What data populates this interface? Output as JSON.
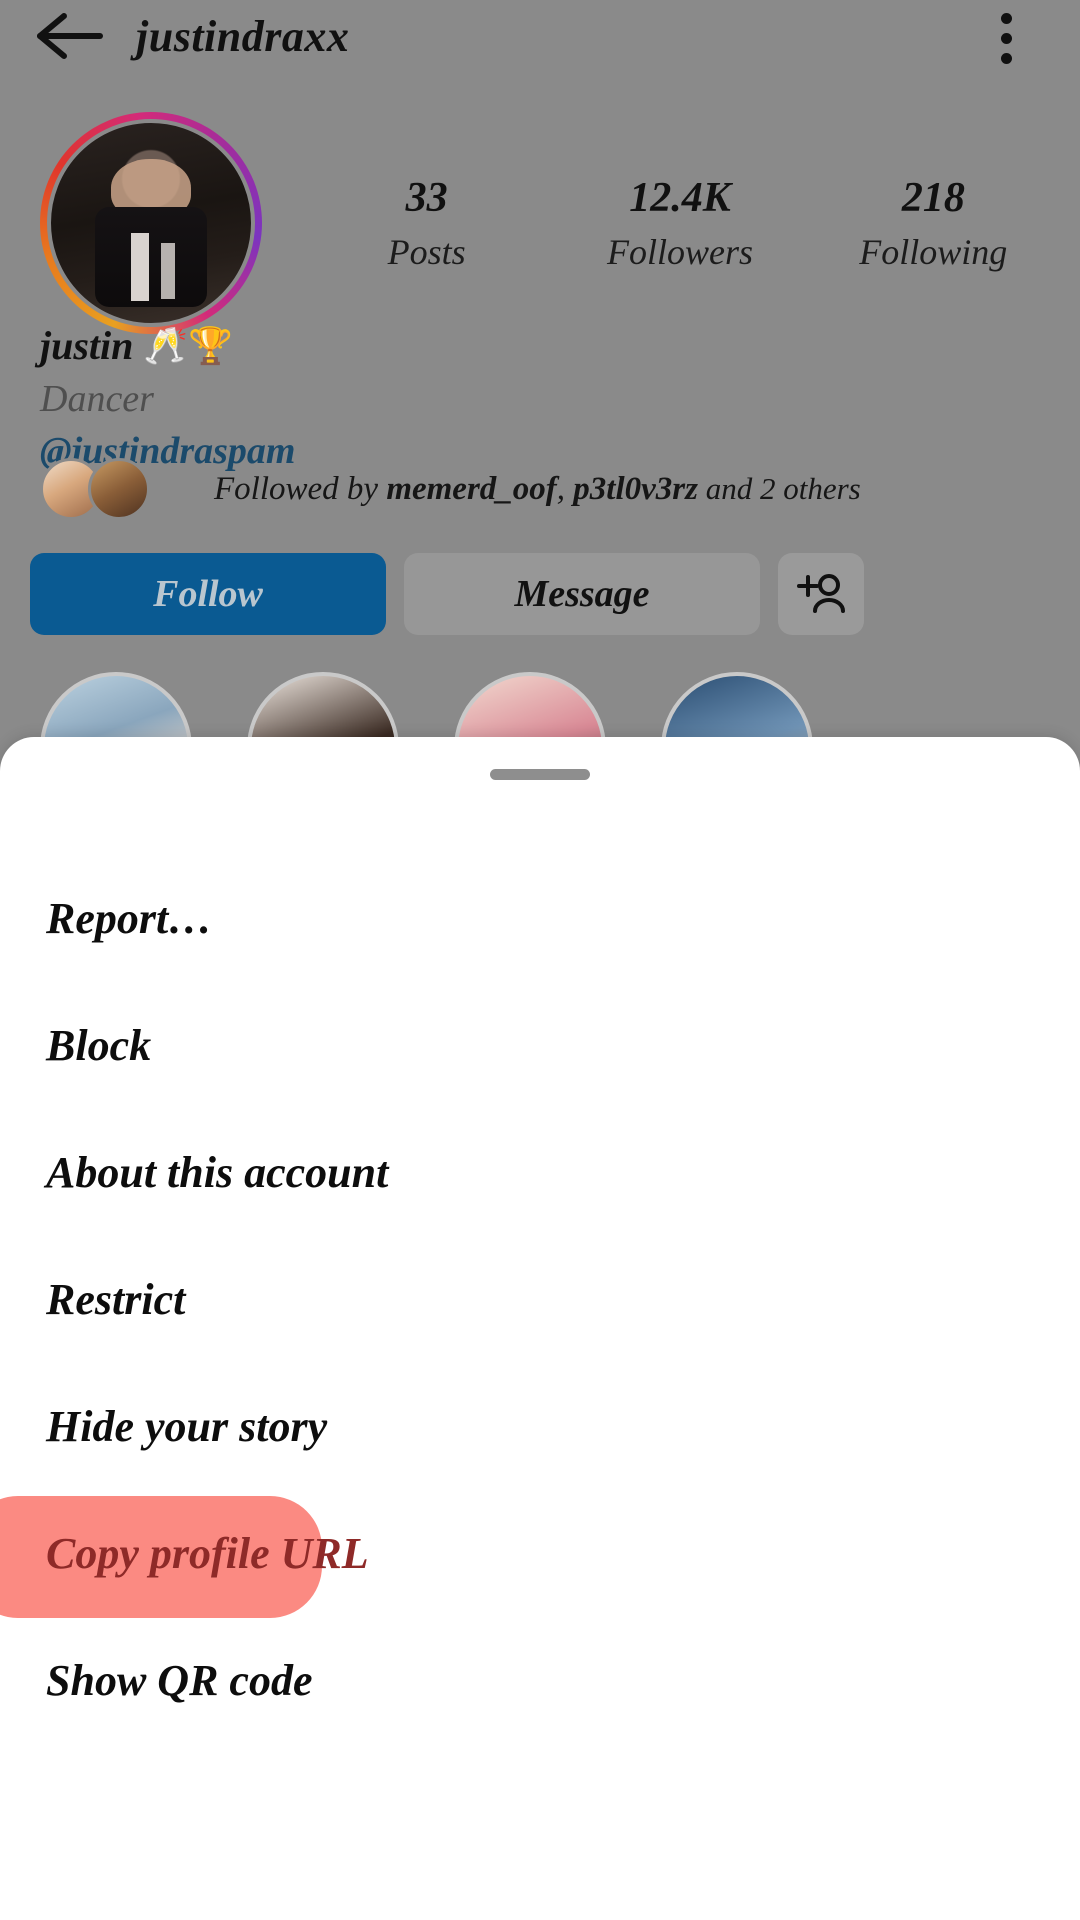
{
  "header": {
    "back_icon": "arrow-left-icon",
    "title": "justindraxx",
    "menu_icon": "kebab-menu-icon"
  },
  "profile": {
    "avatar_icon": "profile-avatar-with-story-ring",
    "display_name": "justin",
    "name_emojis": "🥂🏆",
    "category": "Dancer",
    "mention": "@justindraspam",
    "stats": [
      {
        "value": "33",
        "label": "Posts"
      },
      {
        "value": "12.4K",
        "label": "Followers"
      },
      {
        "value": "218",
        "label": "Following"
      }
    ],
    "followed_by": {
      "prefix": "Followed by ",
      "user1": "memerd_oof",
      "separator": ", ",
      "user2": "p3tl0v3rz",
      "suffix": " and 2 others"
    },
    "actions": {
      "follow_label": "Follow",
      "message_label": "Message",
      "add_user_icon": "add-person-icon"
    }
  },
  "bottom_sheet": {
    "grabber_icon": "drag-handle",
    "items": [
      {
        "label": "Report…",
        "highlighted": false
      },
      {
        "label": "Block",
        "highlighted": false
      },
      {
        "label": "About this account",
        "highlighted": false
      },
      {
        "label": "Restrict",
        "highlighted": false
      },
      {
        "label": "Hide your story",
        "highlighted": false
      },
      {
        "label": "Copy profile URL",
        "highlighted": true
      },
      {
        "label": "Show QR code",
        "highlighted": false
      }
    ]
  },
  "colors": {
    "follow_button": "#0a5a92",
    "mention_link": "#1b4a6b",
    "highlight": "#fb8a82",
    "highlight_text": "#8e2a28",
    "dim_overlay": "#8a8a8a"
  }
}
